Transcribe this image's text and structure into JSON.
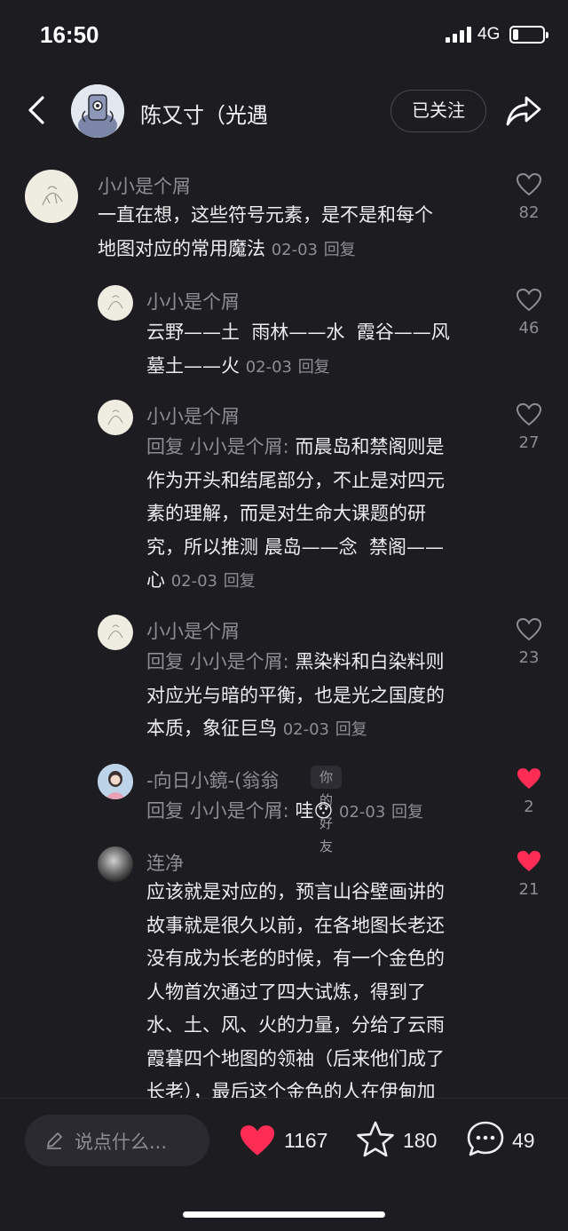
{
  "status": {
    "time": "16:50",
    "network": "4G",
    "battery_level": 0.2
  },
  "header": {
    "name": "陈又寸（光遇",
    "follow_label": "已关注"
  },
  "comments": [
    {
      "user": "小小是个屑",
      "text_lines": [
        "一直在想，这些符号元素，是不是和每个",
        "地图对应的常用魔法"
      ],
      "date": "02-03",
      "reply": "回复",
      "likes": "82",
      "liked": false
    },
    {
      "user": "小小是个屑",
      "text_lines": [
        "云野——土  雨林——水  霞谷——风",
        "墓土——火"
      ],
      "date": "02-03",
      "reply": "回复",
      "likes": "46",
      "liked": false
    },
    {
      "user": "小小是个屑",
      "reply_prefix": "回复 ",
      "reply_to": "小小是个屑:",
      "text_lines": [
        " 而晨岛和禁阁则是",
        "作为开头和结尾部分，不止是对四元",
        "素的理解，而是对生命大课题的研",
        "究，所以推测 晨岛——念  禁阁——",
        "心"
      ],
      "date": "02-03",
      "reply": "回复",
      "likes": "27",
      "liked": false
    },
    {
      "user": "小小是个屑",
      "reply_prefix": "回复 ",
      "reply_to": "小小是个屑:",
      "text_lines": [
        " 黑染料和白染料则",
        "对应光与暗的平衡，也是光之国度的",
        "本质，象征巨鸟"
      ],
      "date": "02-03",
      "reply": "回复",
      "likes": "23",
      "liked": false
    },
    {
      "user": "-向日小鏡-(翁翁",
      "badge": "你的好友",
      "reply_prefix": "回复 ",
      "reply_to": "小小是个屑:",
      "text_lines": [
        " 哇😯"
      ],
      "date": "02-03",
      "reply": "回复",
      "likes": "2",
      "liked": true
    },
    {
      "user": "连净",
      "text_lines": [
        "应该就是对应的，预言山谷壁画讲的",
        "故事就是很久以前，在各地图长老还",
        "没有成为长老的时候，有一个金色的",
        "人物首次通过了四大试炼，得到了",
        "水、土、风、火的力量，分给了云雨",
        "霞暮四个地图的领袖（后来他们成了",
        "长老），最后这个金色的人在伊甸加"
      ],
      "likes": "21",
      "liked": true
    }
  ],
  "bottom": {
    "placeholder": "说点什么...",
    "likes": "1167",
    "favorites": "180",
    "comments": "49"
  },
  "colors": {
    "background": "#1d1c21",
    "like_red": "#ff2d55",
    "muted": "#8e8d93"
  }
}
